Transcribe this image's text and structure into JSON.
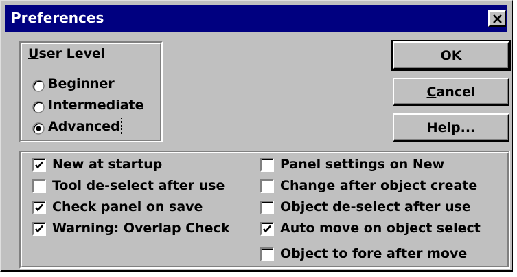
{
  "window": {
    "title": "Preferences",
    "close_icon": "close-icon"
  },
  "user_level": {
    "label_underlined": "U",
    "label_rest": "ser Level",
    "options": [
      {
        "label": "Beginner",
        "selected": false
      },
      {
        "label": "Intermediate",
        "selected": false
      },
      {
        "label": "Advanced",
        "selected": true
      }
    ]
  },
  "buttons": {
    "ok": "OK",
    "cancel_underlined": "C",
    "cancel_rest": "ancel",
    "help": "Help..."
  },
  "options_left": [
    {
      "label": "New at startup",
      "checked": true
    },
    {
      "label": "Tool de-select after use",
      "checked": false
    },
    {
      "label": "Check panel on save",
      "checked": true
    },
    {
      "label": "Warning: Overlap Check",
      "checked": true
    }
  ],
  "options_right": [
    {
      "label": "Panel settings on New",
      "checked": false
    },
    {
      "label": "Change after object create",
      "checked": false
    },
    {
      "label": "Object de-select after use",
      "checked": false
    },
    {
      "label": "Auto move on object select",
      "checked": true
    },
    {
      "label": "Object to fore after move",
      "checked": false
    }
  ],
  "colors": {
    "titlebar": "#000080",
    "face": "#c0c0c0"
  }
}
